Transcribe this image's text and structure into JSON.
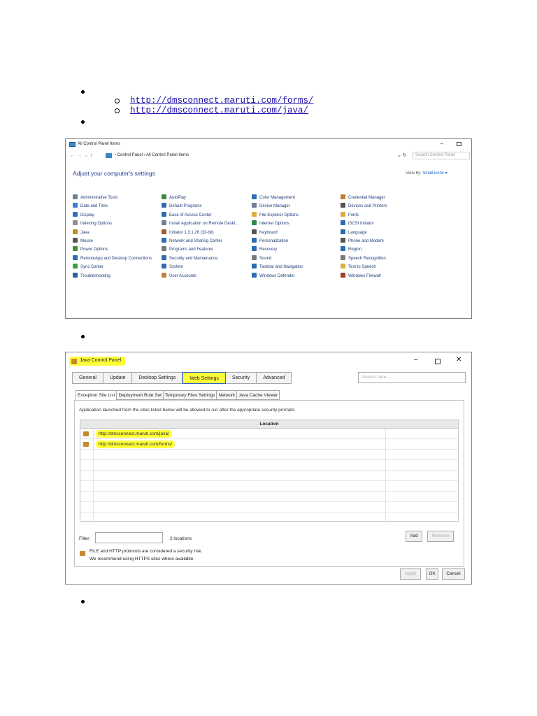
{
  "doc": {
    "links": [
      "http://dmsconnect.maruti.com/forms/",
      "http://dmsconnect.maruti.com/java/"
    ]
  },
  "control_panel": {
    "window_title": "All Control Panel Items",
    "breadcrumb": "›  Control Panel  ›  All Control Panel Items",
    "search_placeholder": "Search Control Panel",
    "heading": "Adjust your computer's settings",
    "view_by_label": "View by:",
    "view_by_value": "Small icons ▾",
    "columns": [
      [
        {
          "label": "Administrative Tools",
          "icon": "admin-tools-icon",
          "color": "#6e7f96"
        },
        {
          "label": "Date and Time",
          "icon": "clock-icon",
          "color": "#3a7bd5"
        },
        {
          "label": "Display",
          "icon": "display-icon",
          "color": "#2f6fc0"
        },
        {
          "label": "Indexing Options",
          "icon": "indexing-icon",
          "color": "#8f8f8f"
        },
        {
          "label": "Java",
          "icon": "java-icon",
          "color": "#c58a2a",
          "highlight": true
        },
        {
          "label": "Mouse",
          "icon": "mouse-icon",
          "color": "#555555"
        },
        {
          "label": "Power Options",
          "icon": "power-icon",
          "color": "#4a8a3a"
        },
        {
          "label": "RemoteApp and Desktop Connections",
          "icon": "remoteapp-icon",
          "color": "#2e6db4"
        },
        {
          "label": "Sync Center",
          "icon": "sync-icon",
          "color": "#3aa03a"
        },
        {
          "label": "Troubleshooting",
          "icon": "troubleshooting-icon",
          "color": "#2f5fa8"
        }
      ],
      [
        {
          "label": "AutoPlay",
          "icon": "autoplay-icon",
          "color": "#3c8a3c"
        },
        {
          "label": "Default Programs",
          "icon": "default-programs-icon",
          "color": "#2e6db4"
        },
        {
          "label": "Ease of Access Center",
          "icon": "ease-access-icon",
          "color": "#2e6db4"
        },
        {
          "label": "Install Application on Remote Deskt...",
          "icon": "install-app-icon",
          "color": "#6e7f96"
        },
        {
          "label": "Initiator 1.3.1.26 (32-bit)",
          "icon": "initiator-icon",
          "color": "#a05a2a"
        },
        {
          "label": "Network and Sharing Center",
          "icon": "network-icon",
          "color": "#2e6db4"
        },
        {
          "label": "Programs and Features",
          "icon": "programs-icon",
          "color": "#7a7a7a"
        },
        {
          "label": "Security and Maintenance",
          "icon": "flag-icon",
          "color": "#2e6db4"
        },
        {
          "label": "System",
          "icon": "system-icon",
          "color": "#2e6db4"
        },
        {
          "label": "User Accounts",
          "icon": "user-accounts-icon",
          "color": "#c0813a"
        }
      ],
      [
        {
          "label": "Color Management",
          "icon": "color-management-icon",
          "color": "#2e6db4"
        },
        {
          "label": "Device Manager",
          "icon": "device-manager-icon",
          "color": "#6e7f96"
        },
        {
          "label": "File Explorer Options",
          "icon": "folder-icon",
          "color": "#d8b040"
        },
        {
          "label": "Internet Options",
          "icon": "internet-icon",
          "color": "#2e8a4a"
        },
        {
          "label": "Keyboard",
          "icon": "keyboard-icon",
          "color": "#555555"
        },
        {
          "label": "Personalization",
          "icon": "personalization-icon",
          "color": "#2e6db4"
        },
        {
          "label": "Recovery",
          "icon": "recovery-icon",
          "color": "#2e6db4"
        },
        {
          "label": "Sound",
          "icon": "sound-icon",
          "color": "#7a7a7a"
        },
        {
          "label": "Taskbar and Navigation",
          "icon": "taskbar-icon",
          "color": "#2e6db4"
        },
        {
          "label": "Windows Defender",
          "icon": "shield-icon",
          "color": "#2e6db4"
        }
      ],
      [
        {
          "label": "Credential Manager",
          "icon": "credential-icon",
          "color": "#c0813a"
        },
        {
          "label": "Devices and Printers",
          "icon": "printer-icon",
          "color": "#555555"
        },
        {
          "label": "Fonts",
          "icon": "fonts-icon",
          "color": "#d8b040"
        },
        {
          "label": "iSCSI Initiator",
          "icon": "iscsi-icon",
          "color": "#2e6db4"
        },
        {
          "label": "Language",
          "icon": "language-icon",
          "color": "#2e6db4"
        },
        {
          "label": "Phone and Modem",
          "icon": "phone-icon",
          "color": "#555555"
        },
        {
          "label": "Region",
          "icon": "region-icon",
          "color": "#2e6db4"
        },
        {
          "label": "Speech Recognition",
          "icon": "microphone-icon",
          "color": "#7a7a7a"
        },
        {
          "label": "Text to Speech",
          "icon": "speech-icon",
          "color": "#d8b040"
        },
        {
          "label": "Windows Firewall",
          "icon": "firewall-icon",
          "color": "#a03a2a"
        }
      ]
    ]
  },
  "java_panel": {
    "window_title": "Java Control Panel",
    "tabs": [
      "General",
      "Update",
      "Desktop Settings",
      "Web Settings",
      "Security",
      "Advanced"
    ],
    "active_tab": "Web Settings",
    "search_placeholder": "Search here ...",
    "subtabs": [
      "Exception Site List",
      "Deployment Rule Set",
      "Temporary Files Settings",
      "Network",
      "Java Cache Viewer"
    ],
    "description": "Application launched from the sites listed below will be allowed to run after the appropriate security prompts",
    "column_header": "Location",
    "locations": [
      "http://dmsconnect.maruti.com/java/",
      "http://dmsconnect.maruti.com/forms/"
    ],
    "filter_label": "Filter:",
    "count_text": "2 locations",
    "add_button": "Add",
    "remove_button": "Remove",
    "warning_line1": "FILE and HTTP protocols are considered a security risk.",
    "warning_line2": "We recommend using HTTPS sites where available.",
    "apply_button": "Apply",
    "ok_button": "OK",
    "cancel_button": "Cancel",
    "highlight_color": "#ffff3a"
  }
}
